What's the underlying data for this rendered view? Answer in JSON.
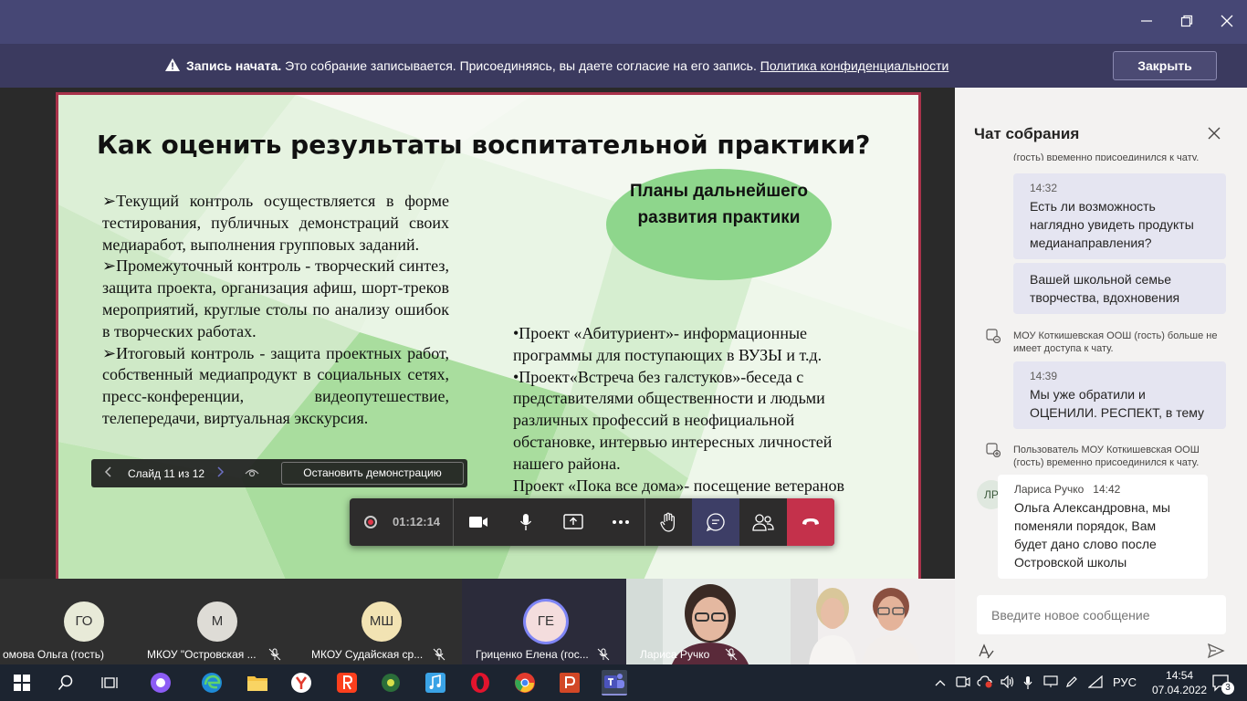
{
  "window": {
    "minimize": "—",
    "maximize": "❐",
    "close": "✕"
  },
  "banner": {
    "bold": "Запись начата.",
    "text": " Это собрание записывается. Присоединяясь, вы даете согласие на его запись. ",
    "link": "Политика конфиденциальности",
    "close_label": "Закрыть"
  },
  "slide": {
    "title": "Как оценить результаты воспитательной практики?",
    "left_paragraphs": [
      "➢Текущий контроль осуществляется в форме тестирования, публичных демонстраций своих медиаработ, выполнения групповых заданий.",
      "➢Промежуточный контроль - творческий синтез, защита проекта, организация афиш, шорт-треков мероприятий, круглые столы по анализу ошибок в творческих работах.",
      "➢Итоговый контроль - защита проектных работ, собственный медиапродукт в социальных сетях, пресс-конференции, видеопутешествие, телепередачи, виртуальная экскурсия."
    ],
    "oval_text": "Планы дальнейшего развития практики",
    "right_paragraphs": [
      "•Проект «Абитуриент»- информационные программы для поступающих в ВУЗЫ и т.д.",
      "•Проект«Встреча без галстуков»-беседа с представителями общественности и людьми различных профессий в неофициальной обстановке, интервью интересных личностей нашего района.",
      "Проект «Пока все дома»- посещение ветеранов педагогического труда"
    ]
  },
  "slide_bar": {
    "counter": "Слайд 11 из 12",
    "stop_label": "Остановить демонстрацию"
  },
  "controls": {
    "timer": "01:12:14"
  },
  "chat": {
    "title": "Чат собрания",
    "top_sys": "(гость) временно присоединился к чату.",
    "msg1_time": "14:32",
    "msg1_text": "Есть ли возможность наглядно увидеть продукты медианаправления?",
    "msg2_text": "Вашей школьной семье творчества, вдохновения",
    "sys1": "МОУ Коткишевская ООШ (гость) больше не имеет доступа к чату.",
    "msg3_time": "14:39",
    "msg3_text": "Мы уже обратили и ОЦЕНИЛИ. РЕСПЕКТ, в тему",
    "sys2_prefix": "Пользователь ",
    "sys2_name": "МОУ Коткишевская ООШ (гость)",
    "sys2_suffix": " временно присоединился к чату.",
    "other_initials": "ЛР",
    "other_name": "Лариса Ручко",
    "other_time": "14:42",
    "other_text": "Ольга Александровна, мы поменяли порядок, Вам будет дано слово после Островской школы",
    "compose_placeholder": "Введите новое сообщение"
  },
  "participants": [
    {
      "initials": "ГО",
      "name": "омова Ольга (гость)",
      "color": "#e8ead8"
    },
    {
      "initials": "М",
      "name": "МКОУ \"Островская ...",
      "color": "#dedcd6"
    },
    {
      "initials": "МШ",
      "name": "МКОУ Судайская ср...",
      "color": "#f2e3b3"
    },
    {
      "initials": "ГЕ",
      "name": "Гриценко Елена (гос...",
      "color": "#f4dddd"
    },
    {
      "initials": "",
      "name": "Лариса Ручко"
    },
    {
      "initials": "",
      "name": ""
    }
  ],
  "taskbar": {
    "lang": "РУС",
    "time": "14:54",
    "date": "07.04.2022",
    "notif": "3"
  }
}
